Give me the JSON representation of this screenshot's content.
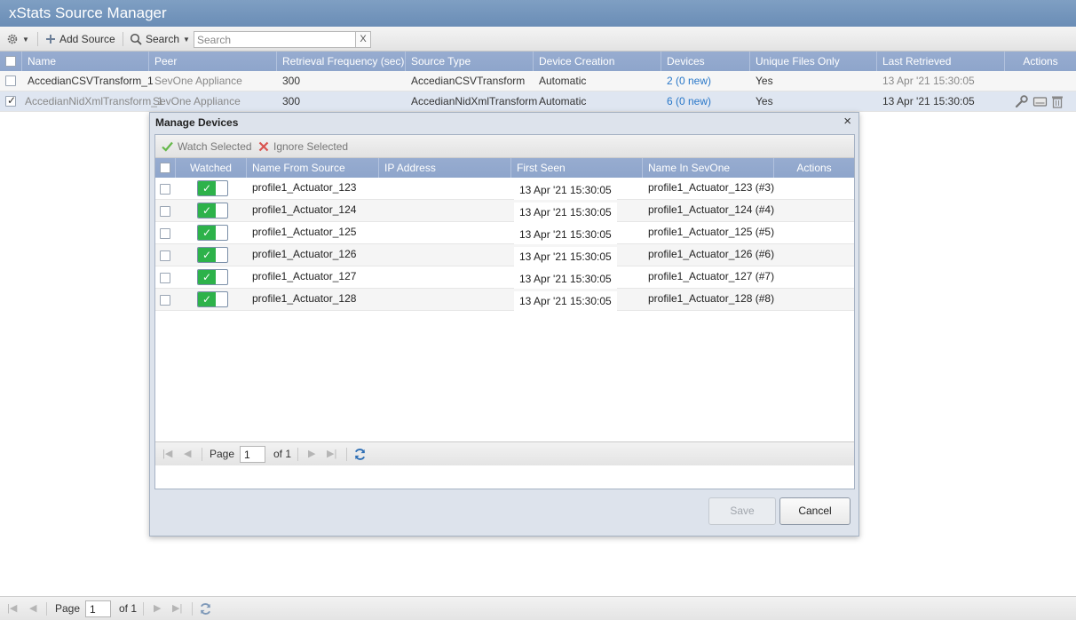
{
  "app": {
    "title": "xStats Source Manager"
  },
  "toolbar": {
    "gear_icon": "gear-icon",
    "add_source_label": "Add Source",
    "search_label": "Search",
    "search_placeholder": "Search",
    "search_clear": "X"
  },
  "sources_grid": {
    "columns": [
      "Name",
      "Peer",
      "Retrieval Frequency (sec)",
      "Source Type",
      "Device Creation",
      "Devices",
      "Unique Files Only",
      "Last Retrieved",
      "Actions"
    ],
    "rows": [
      {
        "name": "AccedianCSVTransform_1",
        "peer": "SevOne Appliance",
        "frequency": "300",
        "source_type": "AccedianCSVTransform",
        "device_creation": "Automatic",
        "devices": "2 (0 new)",
        "unique_files": "Yes",
        "last_retrieved": "13 Apr '21 15:30:05",
        "selected": false
      },
      {
        "name": "AccedianNidXmlTransform_1",
        "peer": "SevOne Appliance",
        "frequency": "300",
        "source_type": "AccedianNidXmlTransform",
        "device_creation": "Automatic",
        "devices": "6 (0 new)",
        "unique_files": "Yes",
        "last_retrieved": "13 Apr '21 15:30:05",
        "selected": true
      }
    ]
  },
  "dialog": {
    "title": "Manage Devices",
    "close": "×",
    "watch_selected": "Watch Selected",
    "ignore_selected": "Ignore Selected",
    "columns": [
      "Watched",
      "Name From Source",
      "IP Address",
      "First Seen",
      "Name In SevOne",
      "Actions"
    ],
    "rows": [
      {
        "watched": true,
        "name_from_source": "profile1_Actuator_123",
        "ip": "",
        "first_seen": "13 Apr '21 15:30:05",
        "name_in_sevone": "profile1_Actuator_123 (#3)"
      },
      {
        "watched": true,
        "name_from_source": "profile1_Actuator_124",
        "ip": "",
        "first_seen": "13 Apr '21 15:30:05",
        "name_in_sevone": "profile1_Actuator_124 (#4)"
      },
      {
        "watched": true,
        "name_from_source": "profile1_Actuator_125",
        "ip": "",
        "first_seen": "13 Apr '21 15:30:05",
        "name_in_sevone": "profile1_Actuator_125 (#5)"
      },
      {
        "watched": true,
        "name_from_source": "profile1_Actuator_126",
        "ip": "",
        "first_seen": "13 Apr '21 15:30:05",
        "name_in_sevone": "profile1_Actuator_126 (#6)"
      },
      {
        "watched": true,
        "name_from_source": "profile1_Actuator_127",
        "ip": "",
        "first_seen": "13 Apr '21 15:30:05",
        "name_in_sevone": "profile1_Actuator_127 (#7)"
      },
      {
        "watched": true,
        "name_from_source": "profile1_Actuator_128",
        "ip": "",
        "first_seen": "13 Apr '21 15:30:05",
        "name_in_sevone": "profile1_Actuator_128 (#8)"
      }
    ],
    "pager": {
      "page_label": "Page",
      "page_value": "1",
      "of_label": "of 1"
    },
    "save_label": "Save",
    "cancel_label": "Cancel"
  },
  "bottom_pager": {
    "page_label": "Page",
    "page_value": "1",
    "of_label": "of 1"
  },
  "colors": {
    "header_blue": "#8ea5cb",
    "title_blue": "#7196bd",
    "link_blue": "#2a78c9",
    "toggle_green": "#2db24a"
  }
}
